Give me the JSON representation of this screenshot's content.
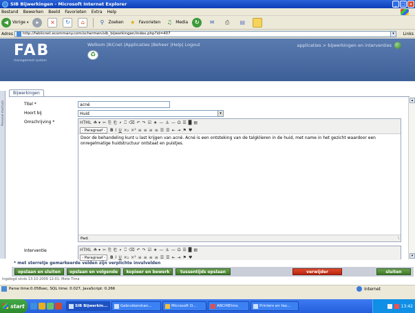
{
  "window": {
    "title": "SIB Bijwerkingen - Microsoft Internet Explorer",
    "controls": [
      "_",
      "□",
      "×"
    ]
  },
  "menu": [
    "Bestand",
    "Bewerken",
    "Beeld",
    "Favorieten",
    "Extra",
    "Help"
  ],
  "toolbar": {
    "back": "Vorige",
    "forward_arrow": "▸",
    "stop": "×",
    "refresh": "↻",
    "home": "⌂",
    "search": "Zoeken",
    "favorites": "Favorieten",
    "media": "Media"
  },
  "address": {
    "label": "Adres",
    "url": "http://fabiicnet.ecommany.com/schermen/sib_bijwerkingen/index.php?id=407",
    "links": "Links"
  },
  "fab": {
    "logo": "FAB",
    "logo_sub": "management system",
    "nav": "Welkom  |IkCnet |Applicaties |Beheer |Help| Logout",
    "breadcrumb": "applicaties > bijwerkingen en interventies",
    "recycle": "♻"
  },
  "sidebar_text": "Personal shortcuts",
  "tab": "Bijwerkingen",
  "form": {
    "titel_label": "Titel *",
    "titel_value": "acné",
    "hoort_label": "Hoort bij",
    "hoort_value": "Huid",
    "omschrijving_label": "Omschrijving *",
    "interventie_label": "Interventie",
    "editor": {
      "format": "- Paragraaf -",
      "content": "Door de behandeling kunt u last krijgen van acné. Acné is een ontsteking van de talgklieren in de huid, met name in het gezicht waardoor een onregelmatige huidstructuur ontstaat en puistjes.",
      "path": "Pad:",
      "row1": [
        "HTML",
        "☘ ▾",
        "✂",
        "⎘",
        "⎗",
        "⎖",
        "⎕",
        "⌫",
        "↶",
        "↷",
        "☑",
        "★",
        "—",
        "⚓",
        "—",
        "Ω",
        "☰",
        "█",
        "▤"
      ],
      "row2": [
        "B",
        "I",
        "U",
        "×₂",
        "×²",
        "≡",
        "≡",
        "≡",
        "≡",
        "☰",
        "☰",
        "⇤",
        "⇥",
        "⚑",
        "♥"
      ]
    }
  },
  "required_note": "* met sterretje gemarkeerde velden zijn verplichte invulvelden",
  "buttons": {
    "save_close": "opslaan en sluiten",
    "save_next": "opslaan en volgende",
    "copy_edit": "kopieer en bewerk",
    "interim_save": "tussentijds opslaan",
    "delete": "verwijder",
    "close": "sluiten"
  },
  "loginfo": "Ingelogd sinds 13-10-2009 12:01: Mete Tima",
  "status": {
    "text": "Parse time:0.058sec, SQL time: 0.027, JavaScript: 0.266",
    "zone": "Internet"
  },
  "taskbar": {
    "start": "start",
    "tasks": [
      "SIB Bijwerkin...",
      "Gebruikershan...",
      "Microsoft O...",
      "ARCHIEtms",
      "Printers en fax..."
    ],
    "clock": "13:42"
  },
  "colors": {
    "header_bg": "#4a6ca4",
    "button_green": "#4f8a36",
    "button_red": "#c8301a",
    "taskbar_blue": "#245edb"
  }
}
